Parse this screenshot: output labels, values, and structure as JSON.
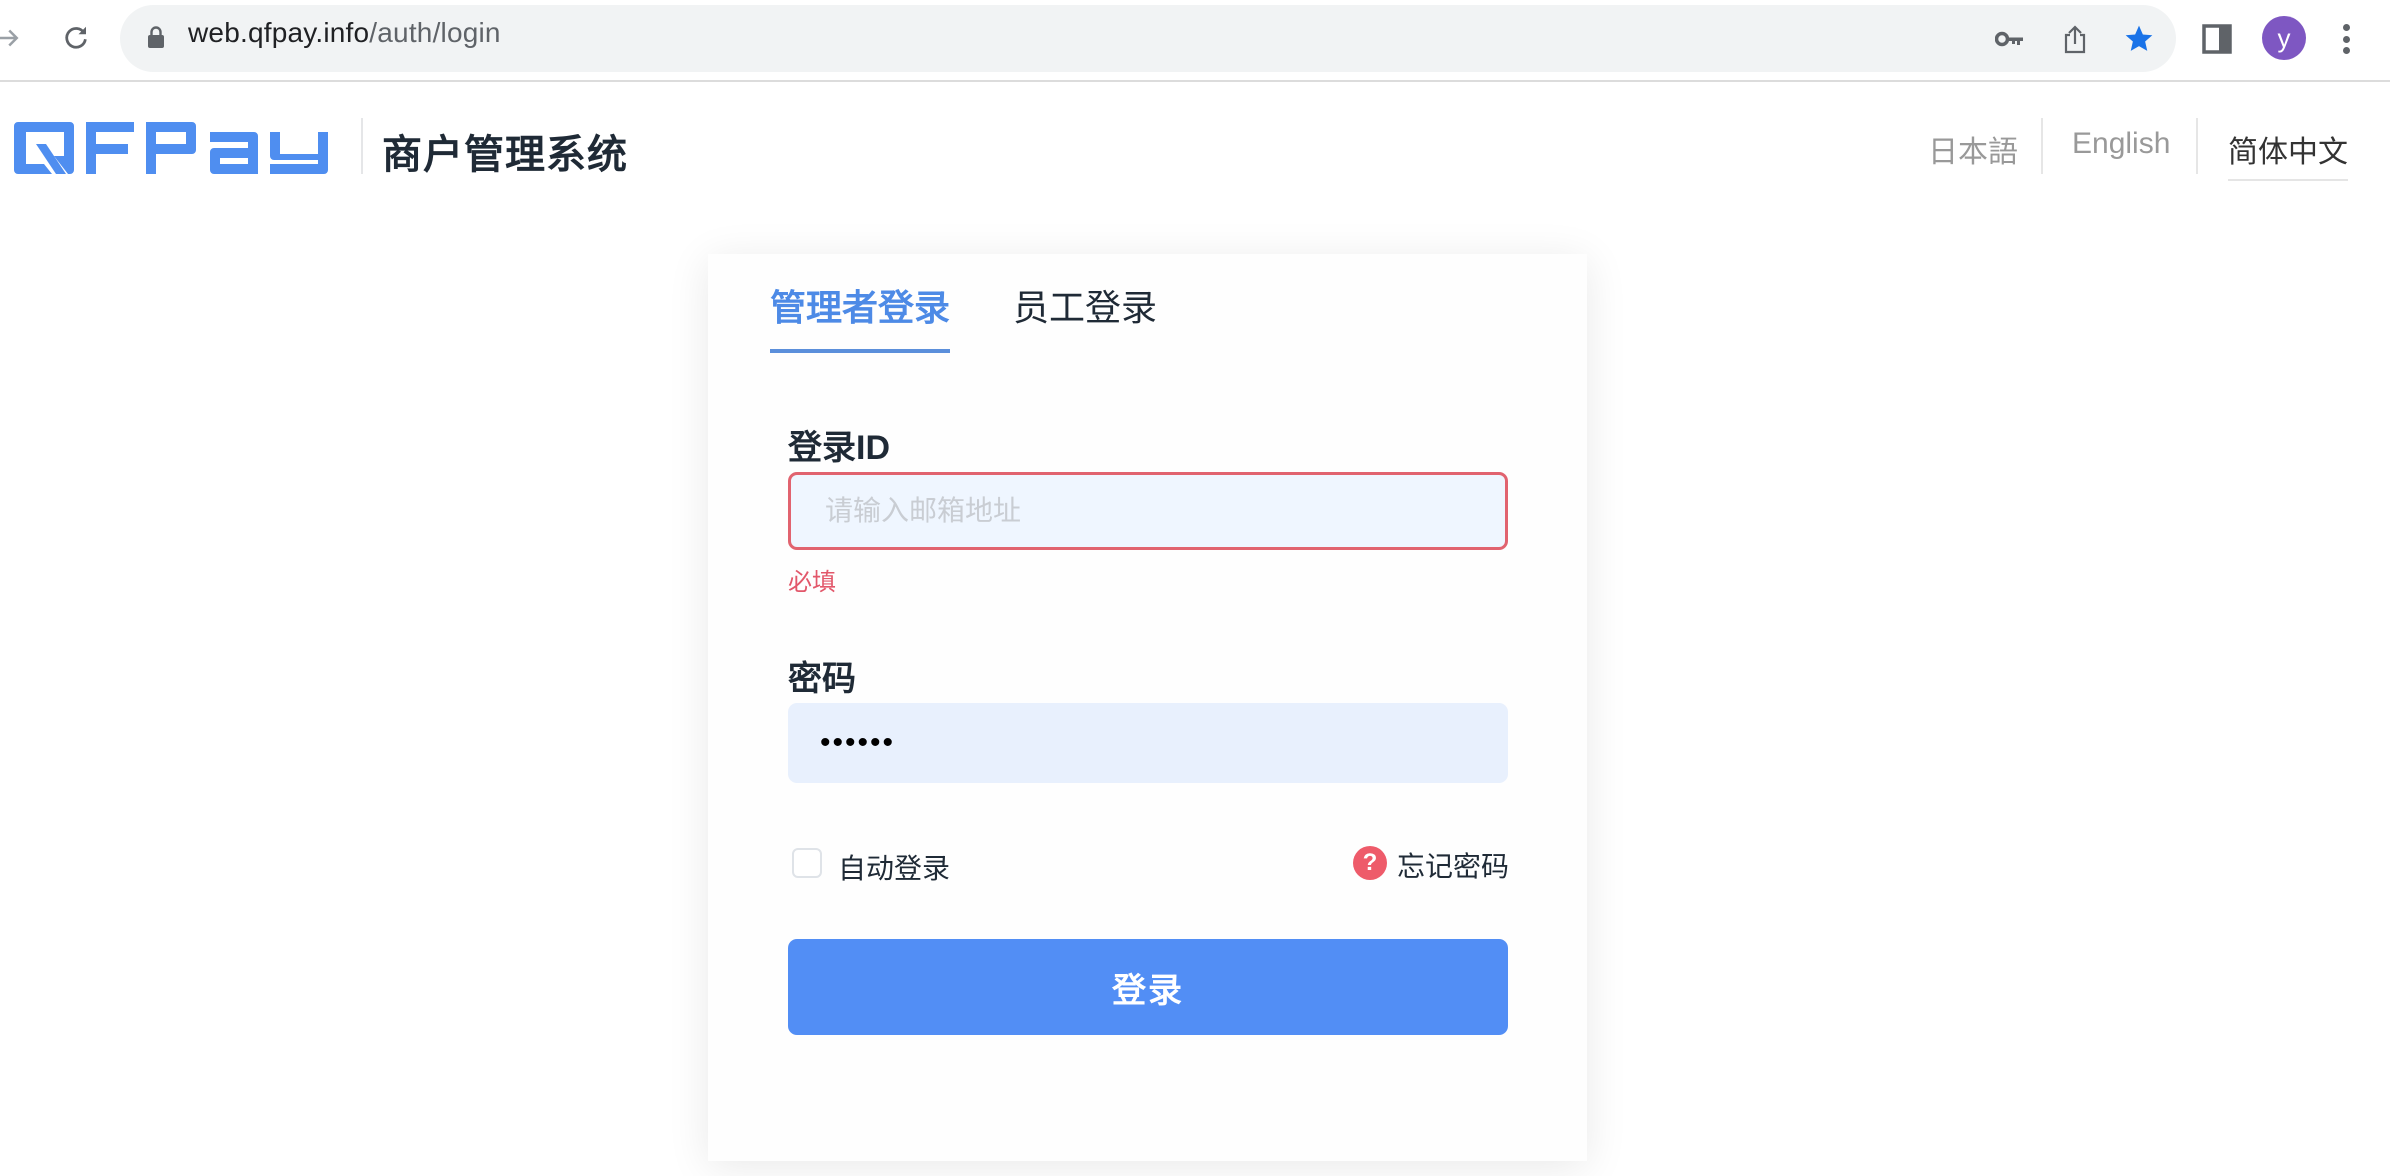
{
  "browser": {
    "url_host": "web.qfpay.info",
    "url_path": "/auth/login",
    "profile_initial": "y",
    "icons": [
      "forward-icon",
      "reload-icon",
      "lock-icon",
      "key-icon",
      "share-icon",
      "bookmark-star-icon",
      "side-panel-icon",
      "avatar",
      "kebab-menu-icon"
    ],
    "star_color": "#1a73e8",
    "avatar_color": "#7e57c2"
  },
  "header": {
    "logo_text": "QFPay",
    "title": "商户管理系统",
    "brand_color": "#4f8ef0",
    "languages": [
      {
        "label": "日本語",
        "active": false
      },
      {
        "label": "English",
        "active": false
      },
      {
        "label": "简体中文",
        "active": true
      }
    ]
  },
  "login": {
    "tabs": [
      {
        "label": "管理者登录",
        "active": true
      },
      {
        "label": "员工登录",
        "active": false
      }
    ],
    "id_field": {
      "label": "登录ID",
      "placeholder": "请输入邮箱地址",
      "value": "",
      "error": "必填"
    },
    "password_field": {
      "label": "密码",
      "value": "••••••"
    },
    "remember": {
      "label": "自动登录",
      "checked": false
    },
    "forgot_password": "忘记密码",
    "submit_label": "登录",
    "colors": {
      "accent": "#528ef5",
      "error": "#e1636f",
      "input_bg": "#e8f0fd"
    }
  }
}
